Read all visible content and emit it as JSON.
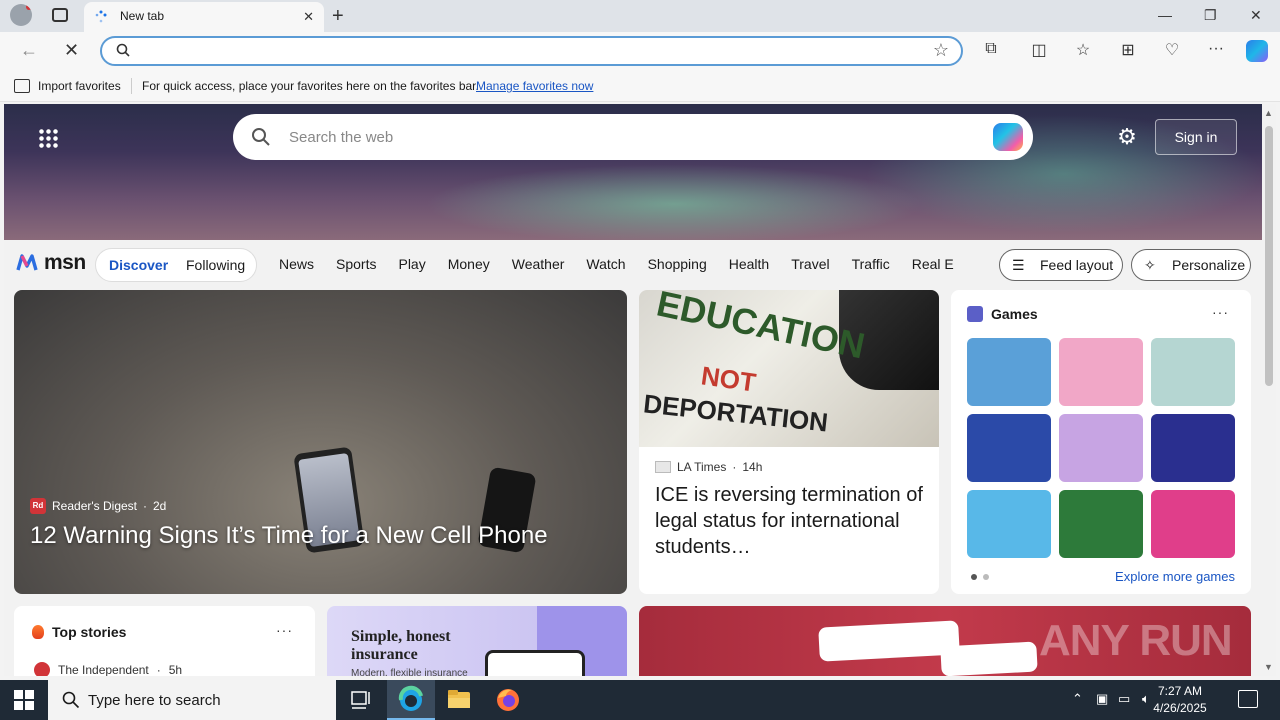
{
  "browser": {
    "tab_title": "New tab",
    "favbar": {
      "import_label": "Import favorites",
      "message": "For quick access, place your favorites here on the favorites bar.",
      "manage_link": "Manage favorites now"
    }
  },
  "msn": {
    "search_placeholder": "Search the web",
    "signin_label": "Sign in",
    "logo_text": "msn",
    "pill": {
      "discover": "Discover",
      "following": "Following"
    },
    "nav_items": [
      "News",
      "Sports",
      "Play",
      "Money",
      "Weather",
      "Watch",
      "Shopping",
      "Health",
      "Travel",
      "Traffic",
      "Real E"
    ],
    "feed_layout_label": "Feed layout",
    "personalize_label": "Personalize"
  },
  "cards": {
    "feature": {
      "source": "Reader's Digest",
      "age": "2d",
      "headline": "12 Warning Signs It’s Time for a New Cell Phone"
    },
    "ice": {
      "source": "LA Times",
      "age": "14h",
      "headline": "ICE is reversing termination of legal status for international students…",
      "sign_line1": "EDUCATION",
      "sign_line2": "NOT",
      "sign_line3": "DEPORTATION"
    },
    "games": {
      "title": "Games",
      "explore": "Explore more games",
      "tile_colors": [
        "#5aa0d8",
        "#f1a7c7",
        "#b5d6d2",
        "#2b4aa8",
        "#c7a4e3",
        "#2a2f8f",
        "#58b8e8",
        "#2d7a3a",
        "#e03e8a"
      ]
    },
    "top_stories": {
      "title": "Top stories",
      "source": "The Independent",
      "age": "5h"
    },
    "ad": {
      "headline": "Simple, honest insurance",
      "sub": "Modern, flexible insurance"
    },
    "red_ad": {
      "watermark": "ANY RUN"
    }
  },
  "taskbar": {
    "search_placeholder": "Type here to search",
    "time": "7:27 AM",
    "date": "4/26/2025"
  }
}
